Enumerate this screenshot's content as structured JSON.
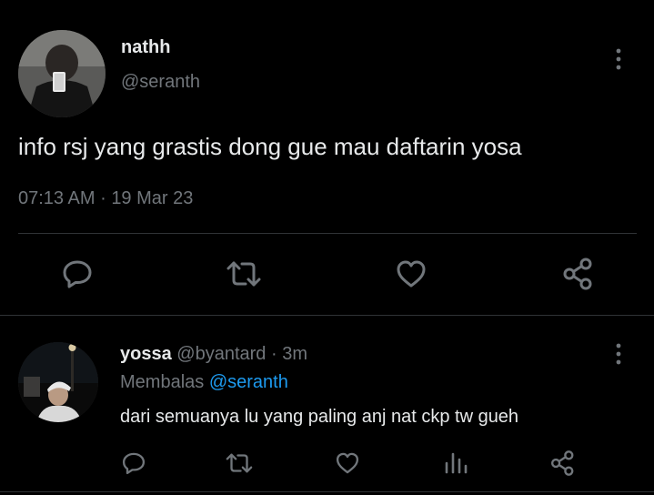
{
  "tweet": {
    "author_name": "nathh",
    "author_handle": "@seranth",
    "text": "info rsj yang grastis dong gue mau daftarin yosa",
    "time": "07:13 AM",
    "separator": "·",
    "date": "19 Mar 23",
    "more_icon": "more-vertical-icon",
    "actions": [
      "reply-icon",
      "retweet-icon",
      "like-icon",
      "share-icon"
    ]
  },
  "reply": {
    "author_name": "yossa",
    "author_handle": "@byantard",
    "separator": "·",
    "age": "3m",
    "replying_label": "Membalas",
    "replying_to": "@seranth",
    "text": "dari semuanya lu yang paling anj nat ckp tw gueh",
    "more_icon": "more-vertical-icon",
    "actions": [
      "reply-icon",
      "retweet-icon",
      "like-icon",
      "analytics-icon",
      "share-icon"
    ]
  },
  "colors": {
    "background": "#000000",
    "text": "#e7e9ea",
    "muted": "#71767b",
    "link": "#1d9bf0",
    "divider": "#2f3336"
  }
}
